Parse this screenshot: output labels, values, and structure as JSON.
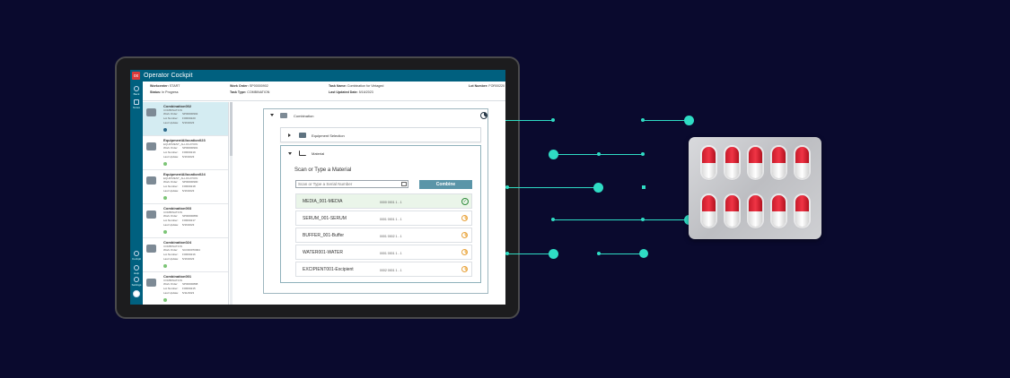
{
  "app": {
    "title": "Operator Cockpit",
    "logo_text": "ox"
  },
  "rail": {
    "items": [
      {
        "label": "Back",
        "icon": "back-icon"
      },
      {
        "label": "Notes",
        "icon": "notes-icon"
      },
      {
        "label": "Cockpit",
        "icon": "cockpit-icon"
      },
      {
        "label": "Help",
        "icon": "help-icon"
      },
      {
        "label": "Settings",
        "icon": "settings-icon"
      }
    ]
  },
  "info": {
    "workcenter_label": "Workcenter:",
    "workcenter_value": "START",
    "status_label": "Status:",
    "status_value": "In Progress",
    "work_order_label": "Work Order:",
    "work_order_value": "SP00000902",
    "task_type_label": "Task Type:",
    "task_type_value": "COMBINATION",
    "task_name_label": "Task Name:",
    "task_name_value": "Combination for Vintaged",
    "last_updated_label": "Last Updated Date:",
    "last_updated_value": "5/16/2023",
    "lot_number_label": "Lot Number:",
    "lot_number_value": "FOR00220"
  },
  "worklist": {
    "row_labels": {
      "work_order": "Work Order:",
      "lot_number": "Lot Number:",
      "last_update": "Last Update:"
    },
    "items": [
      {
        "title": "Combination002",
        "sub": "COMBINATION",
        "work_order": "SP00000902",
        "lot_number": "FOR00220",
        "last_update": "5/16/2023",
        "status": "pending"
      },
      {
        "title": "EquipmentAllocation023",
        "sub": "EQUIPMENT_ALLOCATION",
        "work_order": "SP00000901",
        "lot_number": "FOR00219",
        "last_update": "5/16/2023",
        "status": "done"
      },
      {
        "title": "EquipmentAllocation024",
        "sub": "EQUIPMENT_ALLOCATION",
        "work_order": "SP00000900",
        "lot_number": "FOR00218",
        "last_update": "5/16/2023",
        "status": "done"
      },
      {
        "title": "Combination003",
        "sub": "COMBINATION",
        "work_order": "SP00000899",
        "lot_number": "FOR00217",
        "last_update": "5/16/2023",
        "status": "done"
      },
      {
        "title": "Combination024",
        "sub": "COMBINATION",
        "work_order": "SCO00070004",
        "lot_number": "FOR00216",
        "last_update": "5/16/2023",
        "status": "done"
      },
      {
        "title": "Combination001",
        "sub": "COMBINATION",
        "work_order": "SP00000898",
        "lot_number": "FOR00215",
        "last_update": "5/11/2023",
        "status": "done"
      }
    ]
  },
  "task": {
    "header": "Combination",
    "equipment_panel": "Equipment Selection",
    "material_panel": "Material",
    "material_heading": "Scan or Type a Material",
    "scan_placeholder": "Scan or Type a Serial Number",
    "combine_label": "Combine",
    "materials": [
      {
        "name": "MEDIA_001-MEDIA",
        "qty": "0000 0001 1 - 1",
        "status": "complete"
      },
      {
        "name": "SERUM_001-SERUM",
        "qty": "0001 0001 1 - 1",
        "status": "pending"
      },
      {
        "name": "BUFFER_001-Buffer",
        "qty": "0001 0002 1 - 1",
        "status": "pending"
      },
      {
        "name": "WATER001-WATER",
        "qty": "0001 0001 1 - 1",
        "status": "pending"
      },
      {
        "name": "EXCIPIENT001-Excipient",
        "qty": "0002 0001 1 - 1",
        "status": "pending"
      }
    ]
  },
  "colors": {
    "background": "#0a0a2e",
    "titlebar": "#00607f",
    "connector": "#2fdcc4",
    "combine_button": "#5a95a8",
    "pill_red": "#e32b3c"
  }
}
